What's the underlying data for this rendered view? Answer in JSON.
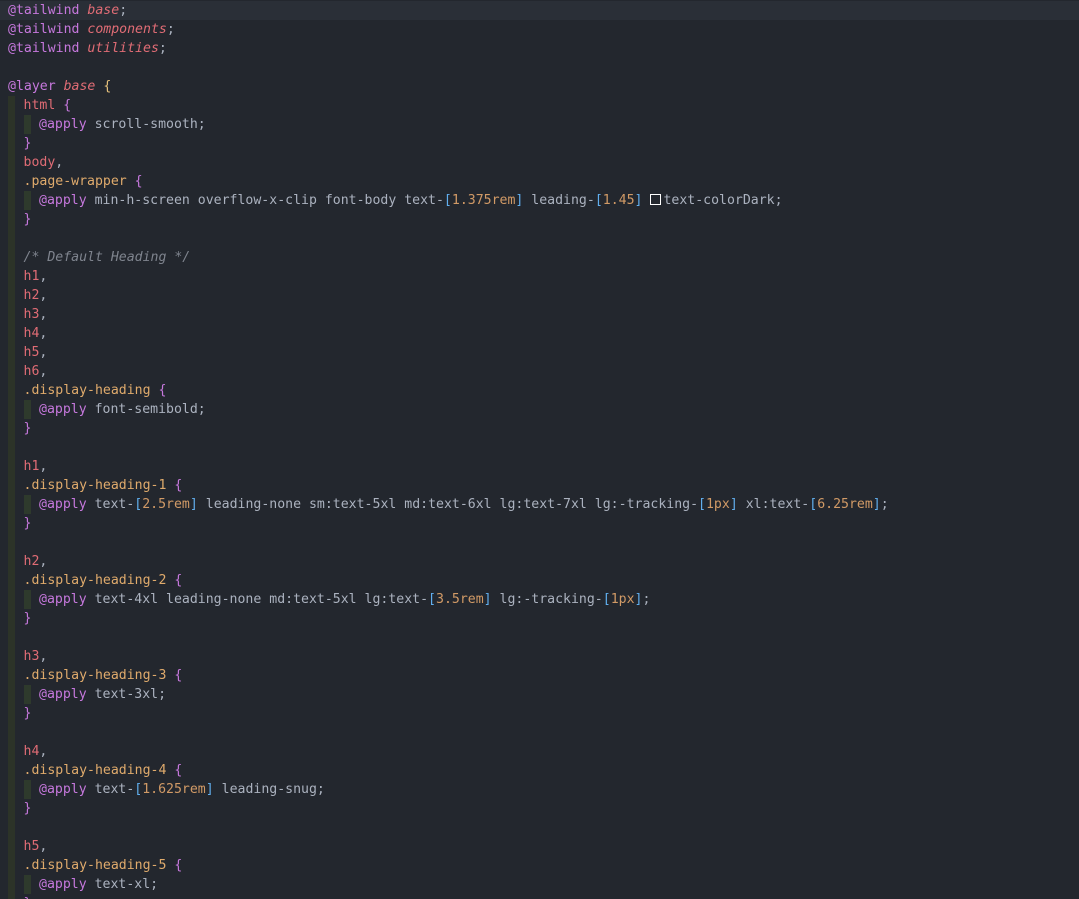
{
  "editor": {
    "language": "css",
    "current_line_index": 0,
    "colors": {
      "background": "#23272e",
      "at_rule": "#c678dd",
      "selector": "#e06c75",
      "class_selector": "#e0ab6c",
      "bracket": "#61afef",
      "number": "#d19a66",
      "comment": "#7f848e",
      "text": "#abb2bf",
      "swatch": "#ffffff"
    },
    "lines": [
      {
        "indent": 0,
        "tokens": [
          {
            "t": "@tailwind",
            "c": "at"
          },
          {
            "t": " ",
            "c": "txt"
          },
          {
            "t": "base",
            "c": "it"
          },
          {
            "t": ";",
            "c": "txt"
          }
        ]
      },
      {
        "indent": 0,
        "tokens": [
          {
            "t": "@tailwind",
            "c": "at"
          },
          {
            "t": " ",
            "c": "txt"
          },
          {
            "t": "components",
            "c": "it"
          },
          {
            "t": ";",
            "c": "txt"
          }
        ]
      },
      {
        "indent": 0,
        "tokens": [
          {
            "t": "@tailwind",
            "c": "at"
          },
          {
            "t": " ",
            "c": "txt"
          },
          {
            "t": "utilities",
            "c": "it"
          },
          {
            "t": ";",
            "c": "txt"
          }
        ]
      },
      {
        "indent": 0,
        "tokens": []
      },
      {
        "indent": 0,
        "tokens": [
          {
            "t": "@layer",
            "c": "at"
          },
          {
            "t": " ",
            "c": "txt"
          },
          {
            "t": "base",
            "c": "it"
          },
          {
            "t": " ",
            "c": "txt"
          },
          {
            "t": "{",
            "c": "brace1"
          }
        ]
      },
      {
        "indent": 1,
        "tokens": [
          {
            "t": "html",
            "c": "sel"
          },
          {
            "t": " ",
            "c": "txt"
          },
          {
            "t": "{",
            "c": "brace2"
          }
        ]
      },
      {
        "indent": 2,
        "tokens": [
          {
            "t": "@apply",
            "c": "at"
          },
          {
            "t": " scroll-smooth;",
            "c": "txt"
          }
        ]
      },
      {
        "indent": 1,
        "tokens": [
          {
            "t": "}",
            "c": "brace2"
          }
        ]
      },
      {
        "indent": 1,
        "tokens": [
          {
            "t": "body",
            "c": "sel"
          },
          {
            "t": ",",
            "c": "txt"
          }
        ]
      },
      {
        "indent": 1,
        "tokens": [
          {
            "t": ".page-wrapper",
            "c": "cls"
          },
          {
            "t": " ",
            "c": "txt"
          },
          {
            "t": "{",
            "c": "brace2"
          }
        ]
      },
      {
        "indent": 2,
        "tokens": [
          {
            "t": "@apply",
            "c": "at"
          },
          {
            "t": " min-h-screen overflow-x-clip font-body text-",
            "c": "txt"
          },
          {
            "t": "[",
            "c": "bracket"
          },
          {
            "t": "1.375rem",
            "c": "num"
          },
          {
            "t": "]",
            "c": "bracket"
          },
          {
            "t": " leading-",
            "c": "txt"
          },
          {
            "t": "[",
            "c": "bracket"
          },
          {
            "t": "1.45",
            "c": "num"
          },
          {
            "t": "]",
            "c": "bracket"
          },
          {
            "t": " ",
            "c": "txt"
          },
          {
            "t": "",
            "c": "swatch"
          },
          {
            "t": "text-colorDark;",
            "c": "txt"
          }
        ]
      },
      {
        "indent": 1,
        "tokens": [
          {
            "t": "}",
            "c": "brace2"
          }
        ]
      },
      {
        "indent": 1,
        "tokens": []
      },
      {
        "indent": 1,
        "tokens": [
          {
            "t": "/* Default Heading */",
            "c": "cmt"
          }
        ]
      },
      {
        "indent": 1,
        "tokens": [
          {
            "t": "h1",
            "c": "sel"
          },
          {
            "t": ",",
            "c": "txt"
          }
        ]
      },
      {
        "indent": 1,
        "tokens": [
          {
            "t": "h2",
            "c": "sel"
          },
          {
            "t": ",",
            "c": "txt"
          }
        ]
      },
      {
        "indent": 1,
        "tokens": [
          {
            "t": "h3",
            "c": "sel"
          },
          {
            "t": ",",
            "c": "txt"
          }
        ]
      },
      {
        "indent": 1,
        "tokens": [
          {
            "t": "h4",
            "c": "sel"
          },
          {
            "t": ",",
            "c": "txt"
          }
        ]
      },
      {
        "indent": 1,
        "tokens": [
          {
            "t": "h5",
            "c": "sel"
          },
          {
            "t": ",",
            "c": "txt"
          }
        ]
      },
      {
        "indent": 1,
        "tokens": [
          {
            "t": "h6",
            "c": "sel"
          },
          {
            "t": ",",
            "c": "txt"
          }
        ]
      },
      {
        "indent": 1,
        "tokens": [
          {
            "t": ".display-heading",
            "c": "cls"
          },
          {
            "t": " ",
            "c": "txt"
          },
          {
            "t": "{",
            "c": "brace2"
          }
        ]
      },
      {
        "indent": 2,
        "tokens": [
          {
            "t": "@apply",
            "c": "at"
          },
          {
            "t": " font-semibold;",
            "c": "txt"
          }
        ]
      },
      {
        "indent": 1,
        "tokens": [
          {
            "t": "}",
            "c": "brace2"
          }
        ]
      },
      {
        "indent": 1,
        "tokens": []
      },
      {
        "indent": 1,
        "tokens": [
          {
            "t": "h1",
            "c": "sel"
          },
          {
            "t": ",",
            "c": "txt"
          }
        ]
      },
      {
        "indent": 1,
        "tokens": [
          {
            "t": ".display-heading-1",
            "c": "cls"
          },
          {
            "t": " ",
            "c": "txt"
          },
          {
            "t": "{",
            "c": "brace2"
          }
        ]
      },
      {
        "indent": 2,
        "tokens": [
          {
            "t": "@apply",
            "c": "at"
          },
          {
            "t": " text-",
            "c": "txt"
          },
          {
            "t": "[",
            "c": "bracket"
          },
          {
            "t": "2.5rem",
            "c": "num"
          },
          {
            "t": "]",
            "c": "bracket"
          },
          {
            "t": " leading-none sm:text-5xl md:text-6xl lg:text-7xl lg:-tracking-",
            "c": "txt"
          },
          {
            "t": "[",
            "c": "bracket"
          },
          {
            "t": "1px",
            "c": "num"
          },
          {
            "t": "]",
            "c": "bracket"
          },
          {
            "t": " xl:text-",
            "c": "txt"
          },
          {
            "t": "[",
            "c": "bracket"
          },
          {
            "t": "6.25rem",
            "c": "num"
          },
          {
            "t": "]",
            "c": "bracket"
          },
          {
            "t": ";",
            "c": "txt"
          }
        ]
      },
      {
        "indent": 1,
        "tokens": [
          {
            "t": "}",
            "c": "brace2"
          }
        ]
      },
      {
        "indent": 1,
        "tokens": []
      },
      {
        "indent": 1,
        "tokens": [
          {
            "t": "h2",
            "c": "sel"
          },
          {
            "t": ",",
            "c": "txt"
          }
        ]
      },
      {
        "indent": 1,
        "tokens": [
          {
            "t": ".display-heading-2",
            "c": "cls"
          },
          {
            "t": " ",
            "c": "txt"
          },
          {
            "t": "{",
            "c": "brace2"
          }
        ]
      },
      {
        "indent": 2,
        "tokens": [
          {
            "t": "@apply",
            "c": "at"
          },
          {
            "t": " text-4xl leading-none md:text-5xl lg:text-",
            "c": "txt"
          },
          {
            "t": "[",
            "c": "bracket"
          },
          {
            "t": "3.5rem",
            "c": "num"
          },
          {
            "t": "]",
            "c": "bracket"
          },
          {
            "t": " lg:-tracking-",
            "c": "txt"
          },
          {
            "t": "[",
            "c": "bracket"
          },
          {
            "t": "1px",
            "c": "num"
          },
          {
            "t": "]",
            "c": "bracket"
          },
          {
            "t": ";",
            "c": "txt"
          }
        ]
      },
      {
        "indent": 1,
        "tokens": [
          {
            "t": "}",
            "c": "brace2"
          }
        ]
      },
      {
        "indent": 1,
        "tokens": []
      },
      {
        "indent": 1,
        "tokens": [
          {
            "t": "h3",
            "c": "sel"
          },
          {
            "t": ",",
            "c": "txt"
          }
        ]
      },
      {
        "indent": 1,
        "tokens": [
          {
            "t": ".display-heading-3",
            "c": "cls"
          },
          {
            "t": " ",
            "c": "txt"
          },
          {
            "t": "{",
            "c": "brace2"
          }
        ]
      },
      {
        "indent": 2,
        "tokens": [
          {
            "t": "@apply",
            "c": "at"
          },
          {
            "t": " text-3xl;",
            "c": "txt"
          }
        ]
      },
      {
        "indent": 1,
        "tokens": [
          {
            "t": "}",
            "c": "brace2"
          }
        ]
      },
      {
        "indent": 1,
        "tokens": []
      },
      {
        "indent": 1,
        "tokens": [
          {
            "t": "h4",
            "c": "sel"
          },
          {
            "t": ",",
            "c": "txt"
          }
        ]
      },
      {
        "indent": 1,
        "tokens": [
          {
            "t": ".display-heading-4",
            "c": "cls"
          },
          {
            "t": " ",
            "c": "txt"
          },
          {
            "t": "{",
            "c": "brace2"
          }
        ]
      },
      {
        "indent": 2,
        "tokens": [
          {
            "t": "@apply",
            "c": "at"
          },
          {
            "t": " text-",
            "c": "txt"
          },
          {
            "t": "[",
            "c": "bracket"
          },
          {
            "t": "1.625rem",
            "c": "num"
          },
          {
            "t": "]",
            "c": "bracket"
          },
          {
            "t": " leading-snug;",
            "c": "txt"
          }
        ]
      },
      {
        "indent": 1,
        "tokens": [
          {
            "t": "}",
            "c": "brace2"
          }
        ]
      },
      {
        "indent": 1,
        "tokens": []
      },
      {
        "indent": 1,
        "tokens": [
          {
            "t": "h5",
            "c": "sel"
          },
          {
            "t": ",",
            "c": "txt"
          }
        ]
      },
      {
        "indent": 1,
        "tokens": [
          {
            "t": ".display-heading-5",
            "c": "cls"
          },
          {
            "t": " ",
            "c": "txt"
          },
          {
            "t": "{",
            "c": "brace2"
          }
        ]
      },
      {
        "indent": 2,
        "tokens": [
          {
            "t": "@apply",
            "c": "at"
          },
          {
            "t": " text-xl;",
            "c": "txt"
          }
        ]
      },
      {
        "indent": 1,
        "tokens": [
          {
            "t": "}",
            "c": "brace2"
          }
        ]
      }
    ]
  }
}
